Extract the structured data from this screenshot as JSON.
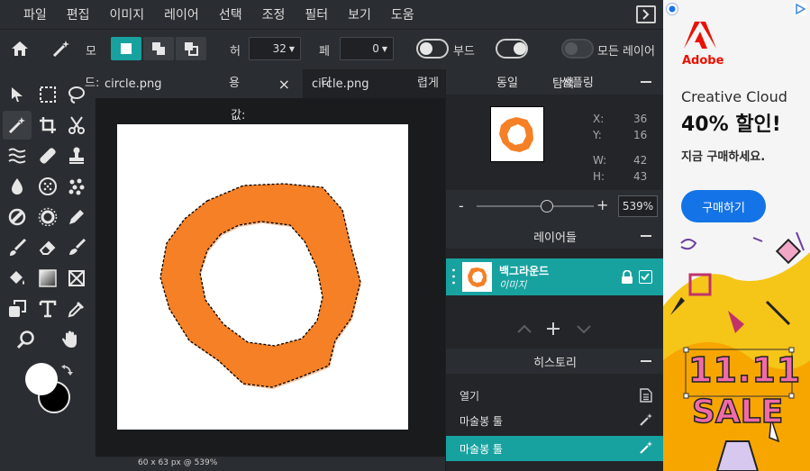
{
  "menu": {
    "items": [
      "파일",
      "편집",
      "이미지",
      "레이어",
      "선택",
      "조정",
      "필터",
      "보기",
      "도움"
    ]
  },
  "tool_options": {
    "mode_label": "모",
    "size_label": "허",
    "size_value": "32",
    "feather_label": "페",
    "feather_value": "0",
    "smooth_label": "부드",
    "all_layers_label": "모든 레이어"
  },
  "tabs": [
    {
      "label": "circle.png",
      "close": "×"
    },
    {
      "label": "circle.png",
      "close": ""
    }
  ],
  "overlays": {
    "drop": "드:",
    "use": "용",
    "do": "디",
    "value": "값:",
    "blend": "렵게",
    "same": "동일",
    "sampling": "샘플링"
  },
  "colors": {
    "accent": "#17a2a0",
    "orange": "#f58025",
    "bg": "#2a2d31",
    "canvas_bg": "#1a1b1d"
  },
  "status": "60 x 63 px @ 539%",
  "navigator": {
    "title": "탐색",
    "x_label": "X:",
    "x_value": "36",
    "y_label": "Y:",
    "y_value": "16",
    "w_label": "W:",
    "w_value": "42",
    "h_label": "H:",
    "h_value": "43",
    "zoom_minus": "-",
    "zoom_plus": "+",
    "zoom_value": "539%",
    "zoom_level_fraction": 0.6
  },
  "layers": {
    "title": "레이어들",
    "items": [
      {
        "name": "백그라운드",
        "type": "이미지"
      }
    ]
  },
  "history": {
    "title": "히스토리",
    "items": [
      {
        "label": "열기",
        "icon": "document-icon"
      },
      {
        "label": "마술봉 툴",
        "icon": "magic-wand-icon"
      },
      {
        "label": "마술봉 툴",
        "icon": "magic-wand-icon",
        "active": true
      }
    ]
  },
  "ad": {
    "brand": "Adobe",
    "product": "Creative Cloud",
    "discount": "40% 할인!",
    "cta_text": "지금 구매하세요.",
    "button": "구매하기",
    "sale_top": "11.11",
    "sale_bottom": "SALE"
  }
}
